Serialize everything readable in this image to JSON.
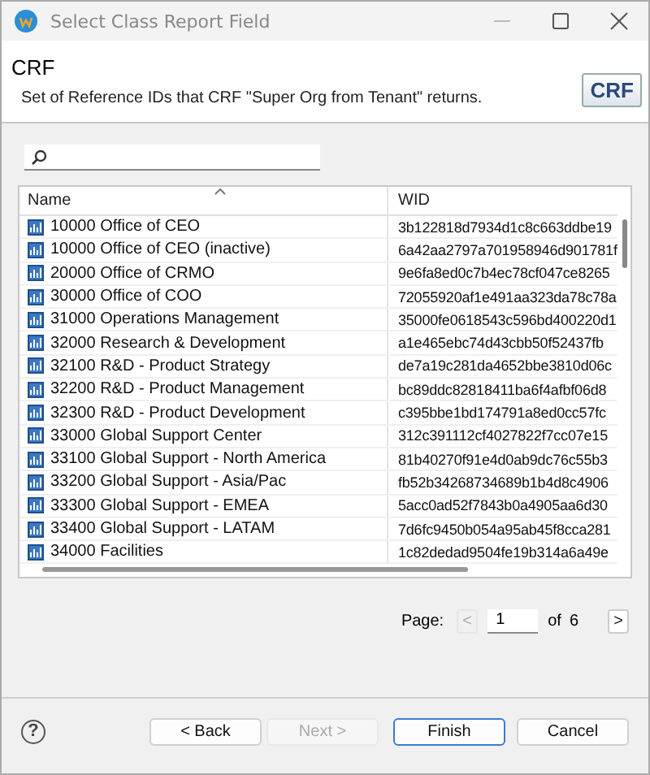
{
  "window": {
    "title": "Select Class Report Field"
  },
  "header": {
    "title": "CRF",
    "description": "Set of Reference IDs that CRF \"Super Org from Tenant\" returns.",
    "badge": "CRF"
  },
  "table": {
    "columns": [
      {
        "label": "Name",
        "sorted": true
      },
      {
        "label": "WID",
        "sorted": false
      }
    ],
    "rows": [
      {
        "name": "10000 Office of CEO",
        "wid": "3b122818d7934d1c8c663ddbe19"
      },
      {
        "name": "10000 Office of CEO (inactive)",
        "wid": "6a42aa2797a701958946d901781f"
      },
      {
        "name": "20000 Office of CRMO",
        "wid": "9e6fa8ed0c7b4ec78cf047ce8265"
      },
      {
        "name": "30000 Office of COO",
        "wid": "72055920af1e491aa323da78c78a"
      },
      {
        "name": "31000 Operations Management",
        "wid": "35000fe0618543c596bd400220d1"
      },
      {
        "name": "32000 Research & Development",
        "wid": "a1e465ebc74d43cbb50f52437fb"
      },
      {
        "name": "32100 R&D - Product Strategy",
        "wid": "de7a19c281da4652bbe3810d06c"
      },
      {
        "name": "32200 R&D - Product Management",
        "wid": "bc89ddc82818411ba6f4afbf06d8"
      },
      {
        "name": "32300 R&D - Product Development",
        "wid": "c395bbe1bd174791a8ed0cc57fc"
      },
      {
        "name": "33000 Global Support Center",
        "wid": "312c391112cf4027822f7cc07e15"
      },
      {
        "name": "33100 Global Support - North America",
        "wid": "81b40270f91e4d0ab9dc76c55b3"
      },
      {
        "name": "33200 Global Support - Asia/Pac",
        "wid": "fb52b34268734689b1b4d8c4906"
      },
      {
        "name": "33300 Global Support - EMEA",
        "wid": "5acc0ad52f7843b0a4905aa6d30"
      },
      {
        "name": "33400 Global Support - LATAM",
        "wid": "7d6fc9450b054a95ab45f8cca281"
      },
      {
        "name": "34000 Facilities",
        "wid": "1c82dedad9504fe19b314a6a49e"
      }
    ]
  },
  "pagination": {
    "label": "Page:",
    "prev": "<",
    "page": "1",
    "of": "of",
    "total": "6",
    "next": ">",
    "prev_disabled": true
  },
  "buttons": [
    {
      "label": "< Back",
      "disabled": false,
      "default": false
    },
    {
      "label": "Next >",
      "disabled": true,
      "default": false
    },
    {
      "label": "Finish",
      "disabled": false,
      "default": true
    },
    {
      "label": "Cancel",
      "disabled": false,
      "default": false
    }
  ],
  "help": "?"
}
